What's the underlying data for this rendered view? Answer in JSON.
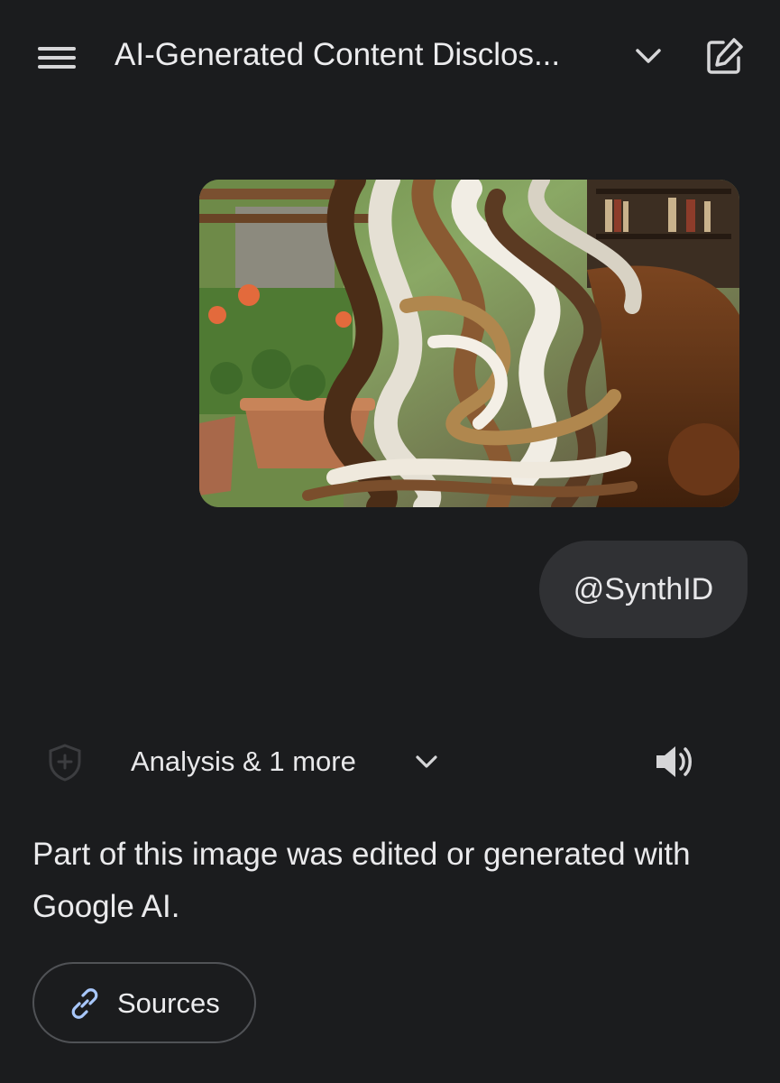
{
  "header": {
    "title": "AI-Generated Content Disclos...",
    "menu_icon": "hamburger-menu-icon",
    "title_dropdown_icon": "chevron-down-icon",
    "new_chat_icon": "edit-icon"
  },
  "conversation": {
    "user_image": {
      "subject": "swirled photo of a window with potted geraniums and a brown leather armchair"
    },
    "user_message": "@SynthID",
    "response": {
      "tools_label": "Analysis & 1 more",
      "tools_icon": "shield-icon",
      "tools_dropdown_icon": "chevron-down-icon",
      "speaker_icon": "speaker-icon",
      "text": "Part of this image was edited or generated with Google AI.",
      "sources_label": "Sources",
      "sources_icon": "link-icon"
    }
  },
  "colors": {
    "background": "#1b1c1e",
    "bubble": "#303134",
    "link_icon": "#a8c7fa"
  }
}
